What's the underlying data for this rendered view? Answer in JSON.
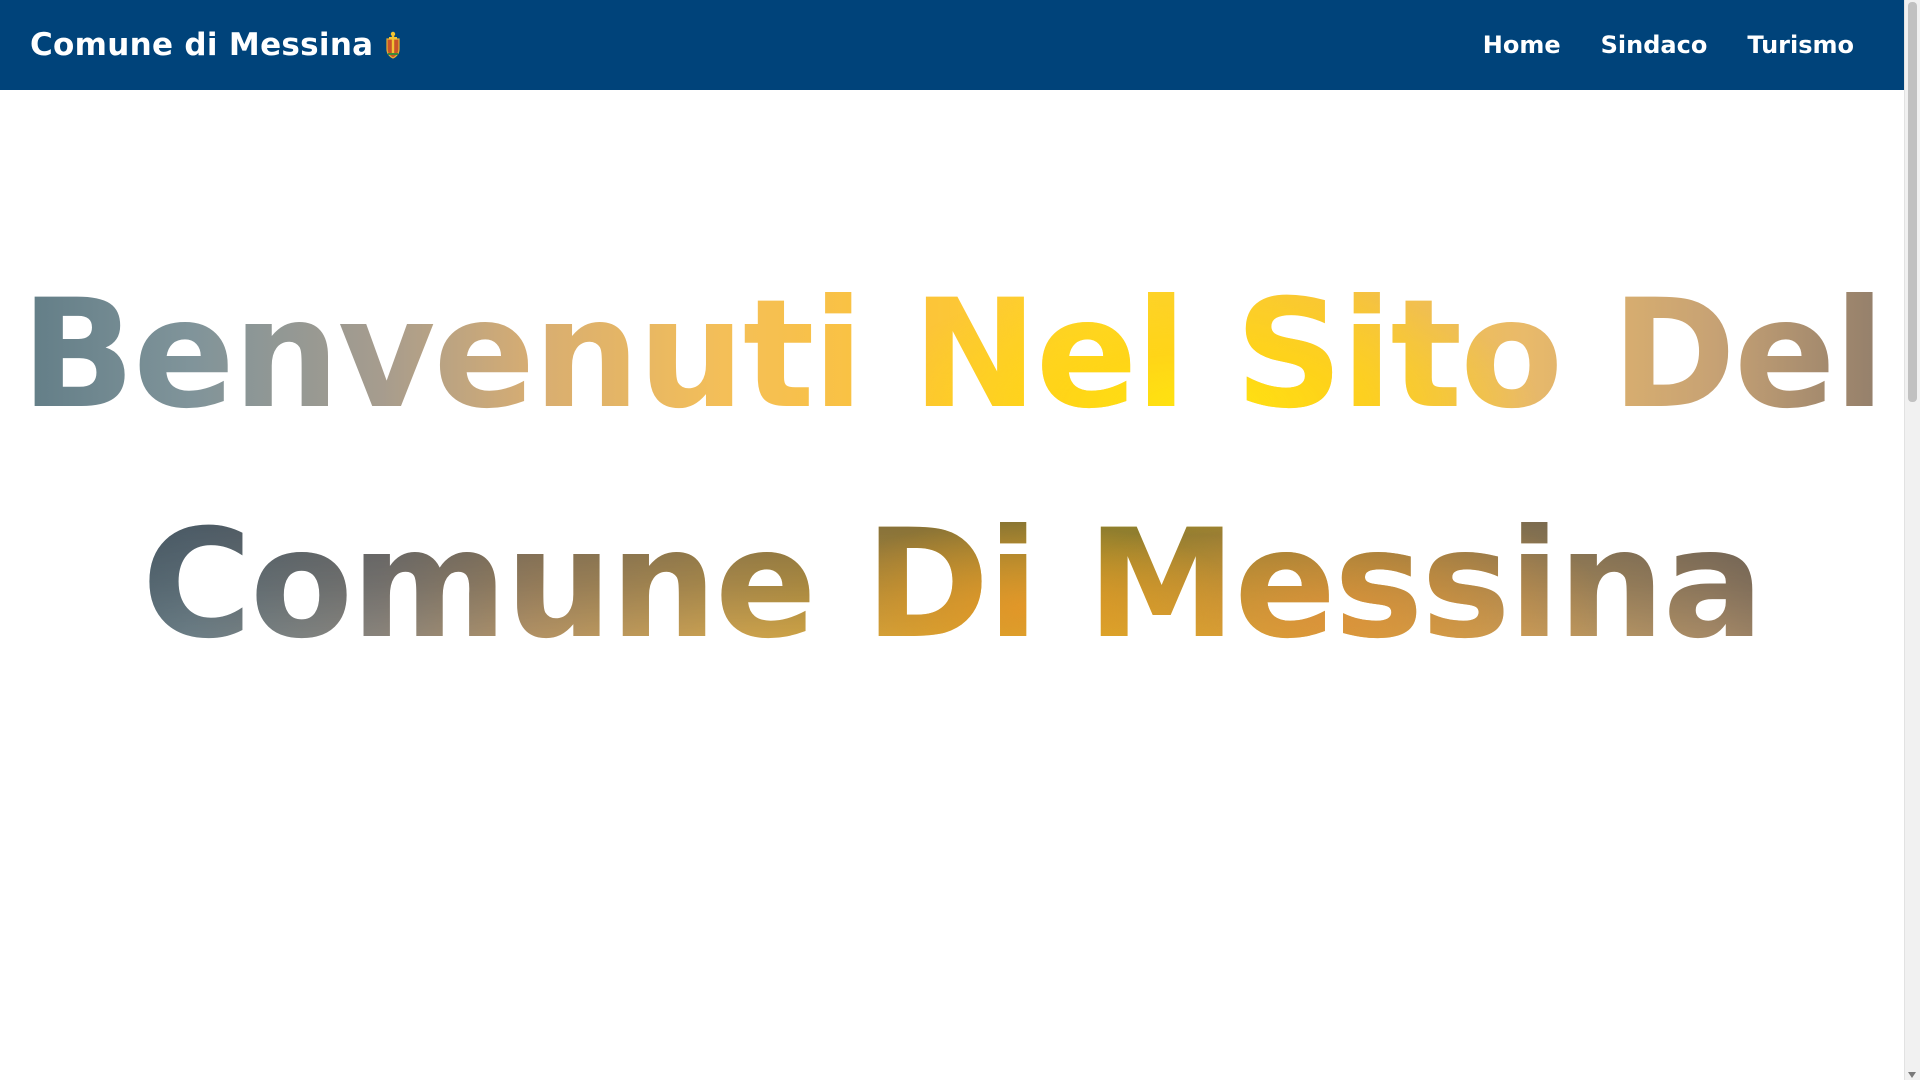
{
  "navbar": {
    "brand": "Comune di Messina",
    "brand_icon": "crest-icon",
    "background": "#00437a",
    "links": [
      {
        "label": "Home"
      },
      {
        "label": "Sindaco"
      },
      {
        "label": "Turismo"
      }
    ]
  },
  "hero": {
    "line1": "Benvenuti Nel Sito Del",
    "line2": "Comune Di Messina"
  }
}
